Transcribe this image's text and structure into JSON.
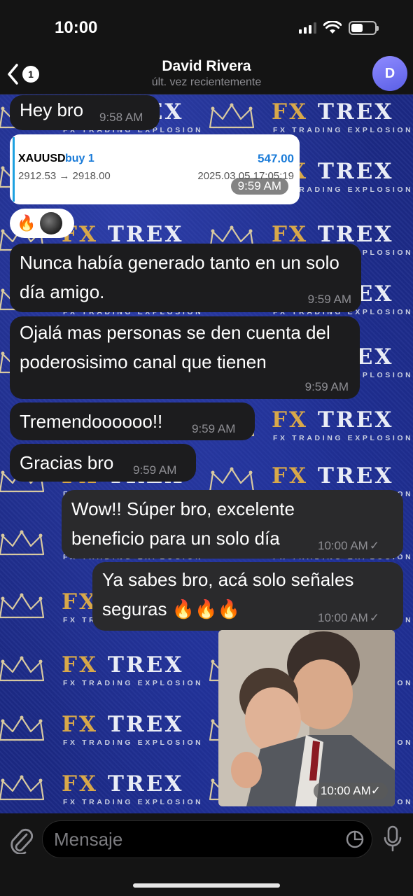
{
  "status_bar": {
    "time": "10:00"
  },
  "header": {
    "back_count": "1",
    "contact_name": "David Rivera",
    "contact_status": "últ. vez recientemente",
    "avatar_letter": "D"
  },
  "wallpaper": {
    "brand_fx": "FX",
    "brand_trex": "TREX",
    "brand_sub": "FX TRADING EXPLOSION"
  },
  "messages": [
    {
      "text": "Hey bro",
      "time": "9:58 AM"
    },
    {
      "trade": {
        "symbol": "XAUUSD",
        "side": "buy 1",
        "profit": "547.00",
        "prices": "2912.53 → 2918.00",
        "date": "2025.03.05 17:05:19"
      },
      "time": "9:59 AM"
    },
    {
      "text": "Nunca había generado tanto en un solo día amigo.",
      "time": "9:59 AM"
    },
    {
      "text": "Ojalá mas personas se den cuenta del poderosisimo canal que tienen",
      "time": "9:59 AM"
    },
    {
      "text": "Tremendoooooo!!",
      "time": "9:59 AM"
    },
    {
      "text": "Gracias bro",
      "time": "9:59 AM"
    },
    {
      "text": "Wow!! Súper bro, excelente beneficio para un solo día",
      "time": "10:00 AM"
    },
    {
      "text": "Ya sabes bro, acá solo señales seguras 🔥🔥🔥",
      "time": "10:00 AM"
    },
    {
      "photo": true,
      "time": "10:00 AM"
    }
  ],
  "reactions": {
    "emoji": "🔥"
  },
  "check_mark": "✓",
  "input": {
    "placeholder": "Mensaje"
  },
  "colors": {
    "wallpaper": "#1c2a86",
    "incoming_bubble": "#1c1c1e",
    "outgoing_bubble": "#2a2a2c",
    "accent": "#1a7bd8",
    "avatar": "#7b78f5"
  }
}
